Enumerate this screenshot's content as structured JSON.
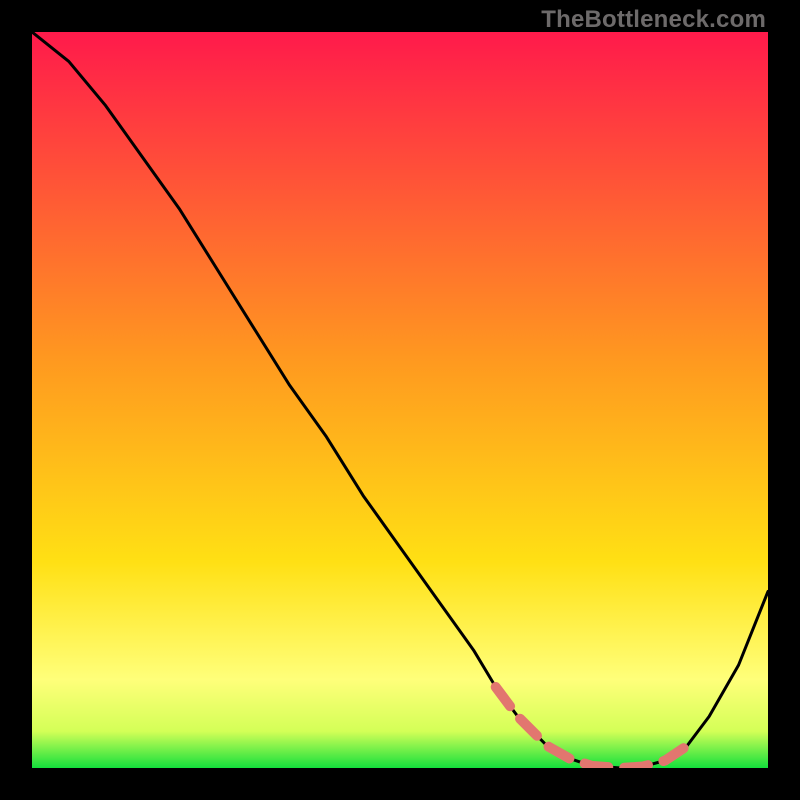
{
  "watermark": "TheBottleneck.com",
  "colors": {
    "bg": "#000000",
    "grad_top": "#ff1a4b",
    "grad_mid": "#ffd614",
    "grad_bottom_band": "#ffff7a",
    "grad_green": "#14e03c",
    "curve": "#000000",
    "dash": "#e2766f"
  },
  "chart_data": {
    "type": "line",
    "title": "",
    "xlabel": "",
    "ylabel": "",
    "xlim": [
      0,
      100
    ],
    "ylim": [
      0,
      100
    ],
    "curve": {
      "name": "bottleneck-curve",
      "x": [
        0,
        5,
        10,
        15,
        20,
        25,
        30,
        35,
        40,
        45,
        50,
        55,
        60,
        63,
        66,
        70,
        73,
        76,
        80,
        83,
        86,
        89,
        92,
        96,
        100
      ],
      "y": [
        100,
        96,
        90,
        83,
        76,
        68,
        60,
        52,
        45,
        37,
        30,
        23,
        16,
        11,
        7,
        3,
        1.3,
        0.3,
        0,
        0.2,
        1.0,
        3,
        7,
        14,
        24
      ]
    },
    "flat_segment": {
      "name": "sweet-spot-band",
      "x": [
        63,
        66,
        70,
        73,
        76,
        80,
        83,
        86,
        89
      ],
      "y": [
        11,
        7,
        3,
        1.3,
        0.3,
        0,
        0.2,
        1.0,
        3
      ]
    }
  }
}
